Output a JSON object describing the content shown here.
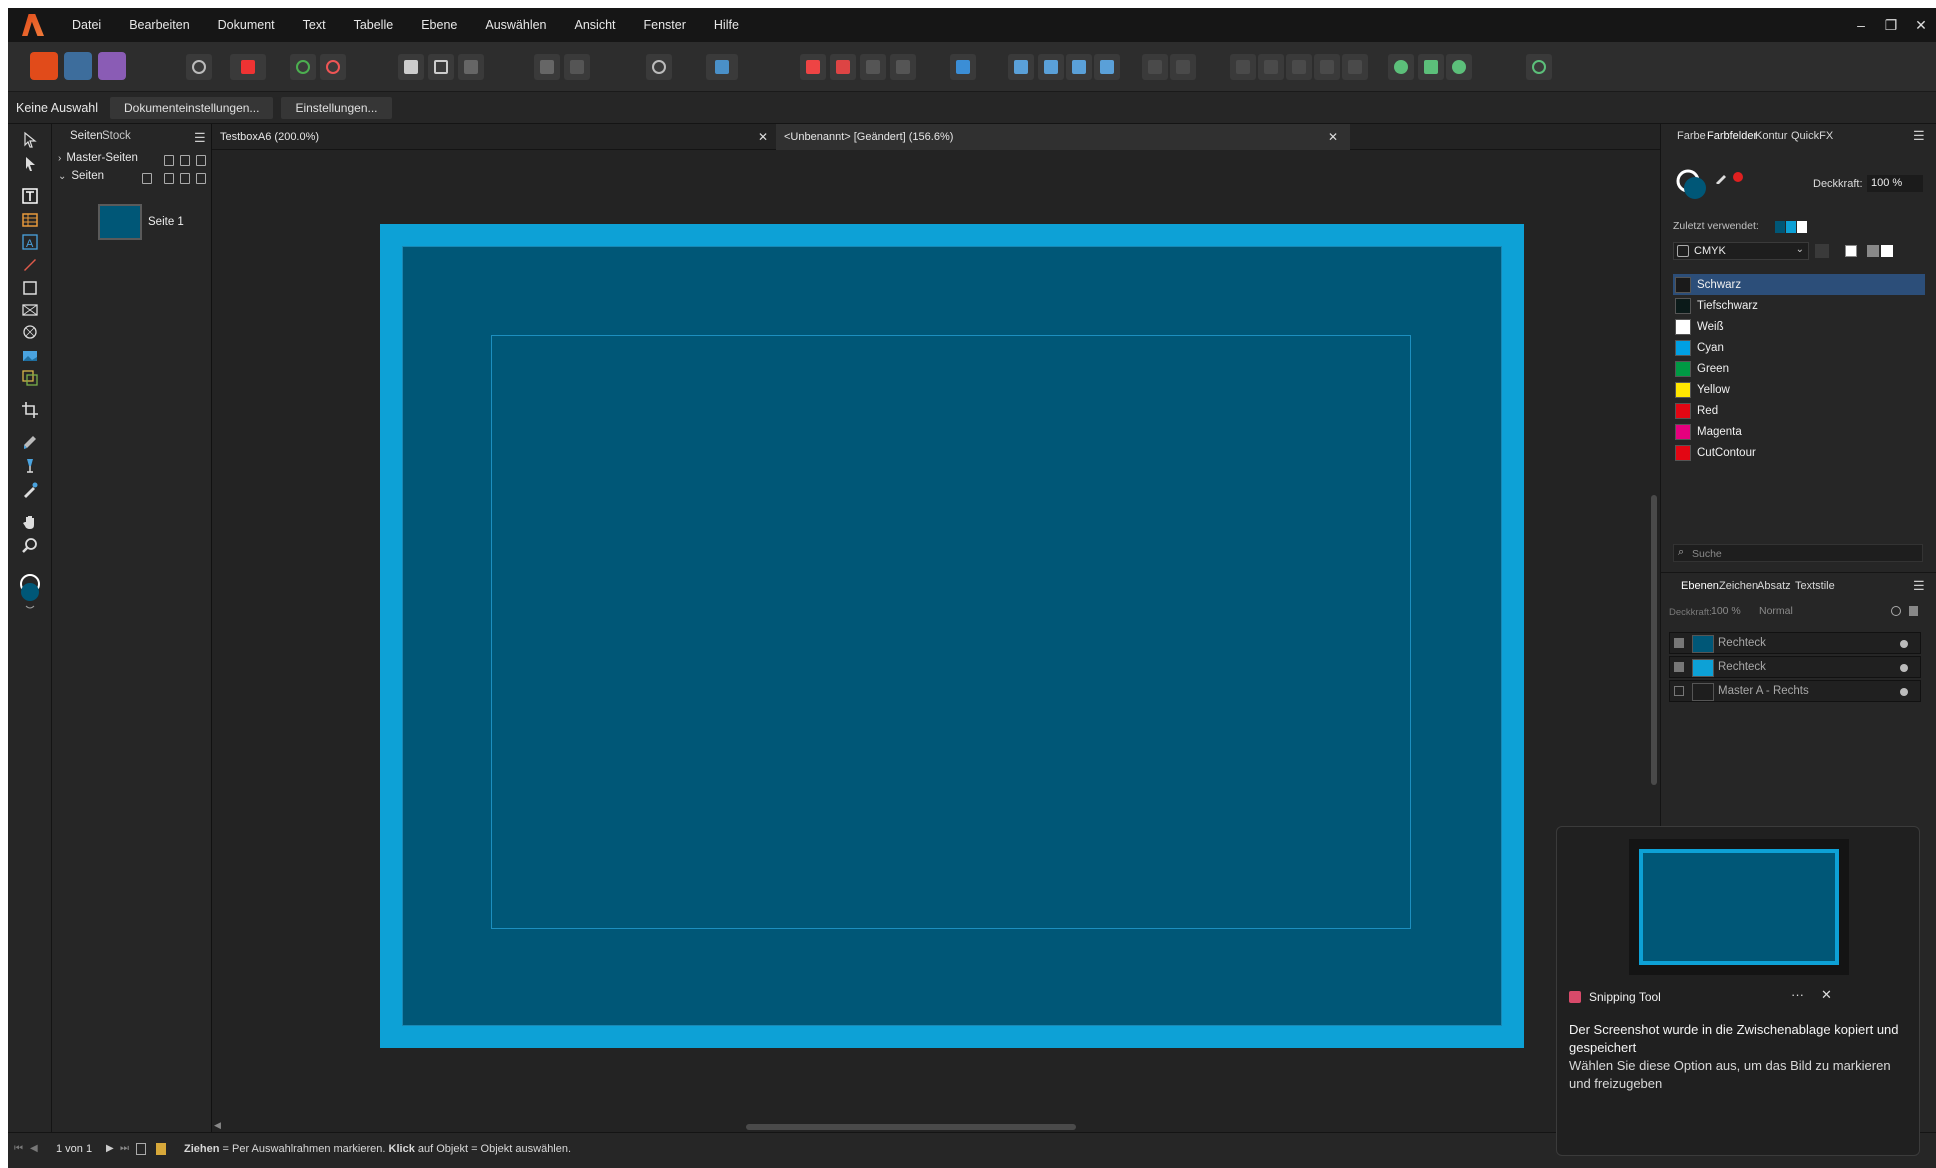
{
  "menu": [
    "Datei",
    "Bearbeiten",
    "Dokument",
    "Text",
    "Tabelle",
    "Ebene",
    "Auswählen",
    "Ansicht",
    "Fenster",
    "Hilfe"
  ],
  "window_controls": [
    "–",
    "❐",
    "✕"
  ],
  "context_bar": {
    "selection": "Keine Auswahl",
    "doc_settings_label": "Dokumenteinstellungen...",
    "settings_label": "Einstellungen..."
  },
  "pages_panel": {
    "tabs": [
      "Seiten",
      "Stock"
    ],
    "master_pages": "Master-Seiten",
    "pages": "Seiten",
    "page1": "Seite 1"
  },
  "doc_tabs": [
    {
      "label": "TestboxA6 (200.0%)"
    },
    {
      "label": "<Unbenannt> [Geändert] (156.6%)"
    }
  ],
  "swatch_panel": {
    "tabs": [
      "Farbe",
      "Farbfelder",
      "Kontur",
      "QuickFX"
    ],
    "opacity_label": "Deckkraft:",
    "opacity_value": "100 %",
    "recent_label": "Zuletzt verwendet:",
    "palette": "CMYK",
    "search_placeholder": "Suche",
    "swatches": [
      {
        "name": "Schwarz",
        "color": "#1a1a1a"
      },
      {
        "name": "Tiefschwarz",
        "color": "#0b1a19"
      },
      {
        "name": "Weiß",
        "color": "#ffffff"
      },
      {
        "name": "Cyan",
        "color": "#00a0e3"
      },
      {
        "name": "Green",
        "color": "#009a44"
      },
      {
        "name": "Yellow",
        "color": "#ffe600"
      },
      {
        "name": "Red",
        "color": "#e30613"
      },
      {
        "name": "Magenta",
        "color": "#e5007e"
      },
      {
        "name": "CutContour",
        "color": "#e30613"
      }
    ]
  },
  "layers_panel": {
    "tabs": [
      "Ebenen",
      "Zeichen",
      "Absatz",
      "Textstile"
    ],
    "opacity_label": "Deckkraft:",
    "opacity_value": "100 %",
    "blend_mode": "Normal",
    "layers": [
      {
        "name": "Rechteck",
        "color": "#005777"
      },
      {
        "name": "Rechteck",
        "color": "#0da1d6"
      },
      {
        "name": "Master A - Rechts",
        "color": "#1e1e1e"
      }
    ]
  },
  "status": {
    "page_count": "1 von 1",
    "hint_drag": "Ziehen",
    "hint_drag_text": " = Per Auswahlrahmen markieren. ",
    "hint_click": "Klick",
    "hint_click_text": " auf Objekt = Objekt auswählen."
  },
  "toast": {
    "app": "Snipping Tool",
    "more": "···",
    "close": "✕",
    "title": "Der Screenshot wurde in die Zwischenablage kopiert und gespeichert",
    "body": "Wählen Sie diese Option aus, um das Bild zu markieren und freizugeben"
  },
  "colors": {
    "page_bleed": "#0da1d6",
    "page_fill": "#005777",
    "selection": "#2c4e79"
  }
}
